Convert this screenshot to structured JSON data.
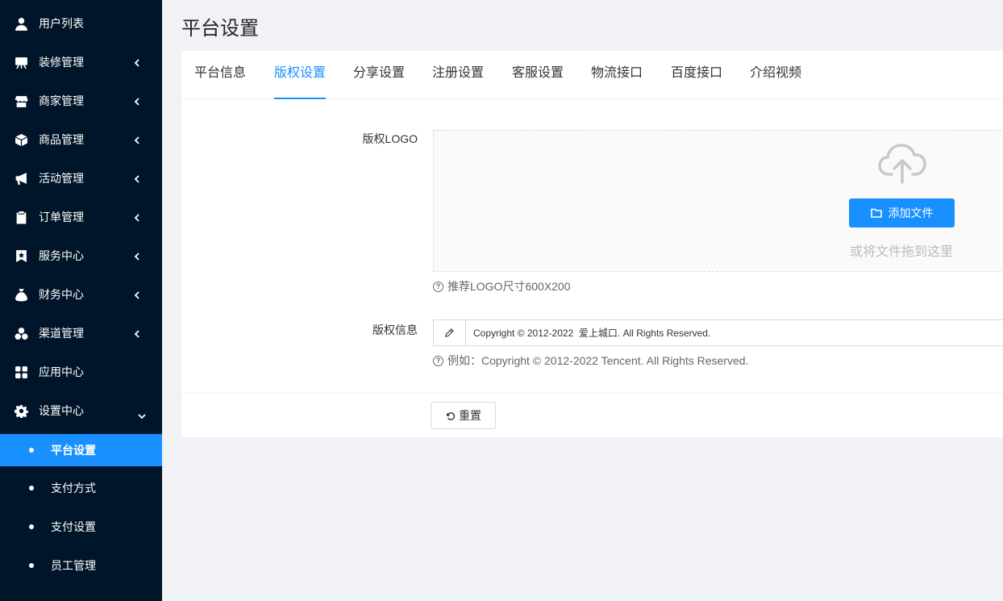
{
  "sidebar": {
    "items": [
      {
        "label": "用户列表",
        "icon": "user-icon",
        "has_arrow": false
      },
      {
        "label": "装修管理",
        "icon": "easel-icon",
        "has_arrow": true
      },
      {
        "label": "商家管理",
        "icon": "store-icon",
        "has_arrow": true
      },
      {
        "label": "商品管理",
        "icon": "cube-icon",
        "has_arrow": true
      },
      {
        "label": "活动管理",
        "icon": "megaphone-icon",
        "has_arrow": true
      },
      {
        "label": "订单管理",
        "icon": "clipboard-icon",
        "has_arrow": true
      },
      {
        "label": "服务中心",
        "icon": "bookmark-star-icon",
        "has_arrow": true
      },
      {
        "label": "财务中心",
        "icon": "money-bag-icon",
        "has_arrow": true
      },
      {
        "label": "渠道管理",
        "icon": "cluster-icon",
        "has_arrow": true
      },
      {
        "label": "应用中心",
        "icon": "apps-grid-icon",
        "has_arrow": false
      },
      {
        "label": "设置中心",
        "icon": "gear-icon",
        "has_arrow": true,
        "expanded": true
      }
    ],
    "sub_items": [
      {
        "label": "平台设置",
        "active": true
      },
      {
        "label": "支付方式",
        "active": false
      },
      {
        "label": "支付设置",
        "active": false
      },
      {
        "label": "员工管理",
        "active": false
      }
    ]
  },
  "page": {
    "title": "平台设置"
  },
  "tabs": [
    {
      "label": "平台信息",
      "active": false
    },
    {
      "label": "版权设置",
      "active": true
    },
    {
      "label": "分享设置",
      "active": false
    },
    {
      "label": "注册设置",
      "active": false
    },
    {
      "label": "客服设置",
      "active": false
    },
    {
      "label": "物流接口",
      "active": false
    },
    {
      "label": "百度接口",
      "active": false
    },
    {
      "label": "介绍视频",
      "active": false
    }
  ],
  "form": {
    "logo_label": "版权LOGO",
    "upload_button": "添加文件",
    "drop_text": "或将文件拖到这里",
    "logo_hint": "推荐LOGO尺寸600X200",
    "info_label": "版权信息",
    "info_value": "Copyright © 2012-2022  爱上城口. All Rights Reserved.",
    "info_hint": "例如：Copyright © 2012-2022 Tencent. All Rights Reserved.",
    "reset_button": "重置"
  },
  "colors": {
    "sidebar_bg": "#001529",
    "accent": "#1890ff",
    "page_bg": "#f0f2f5"
  }
}
